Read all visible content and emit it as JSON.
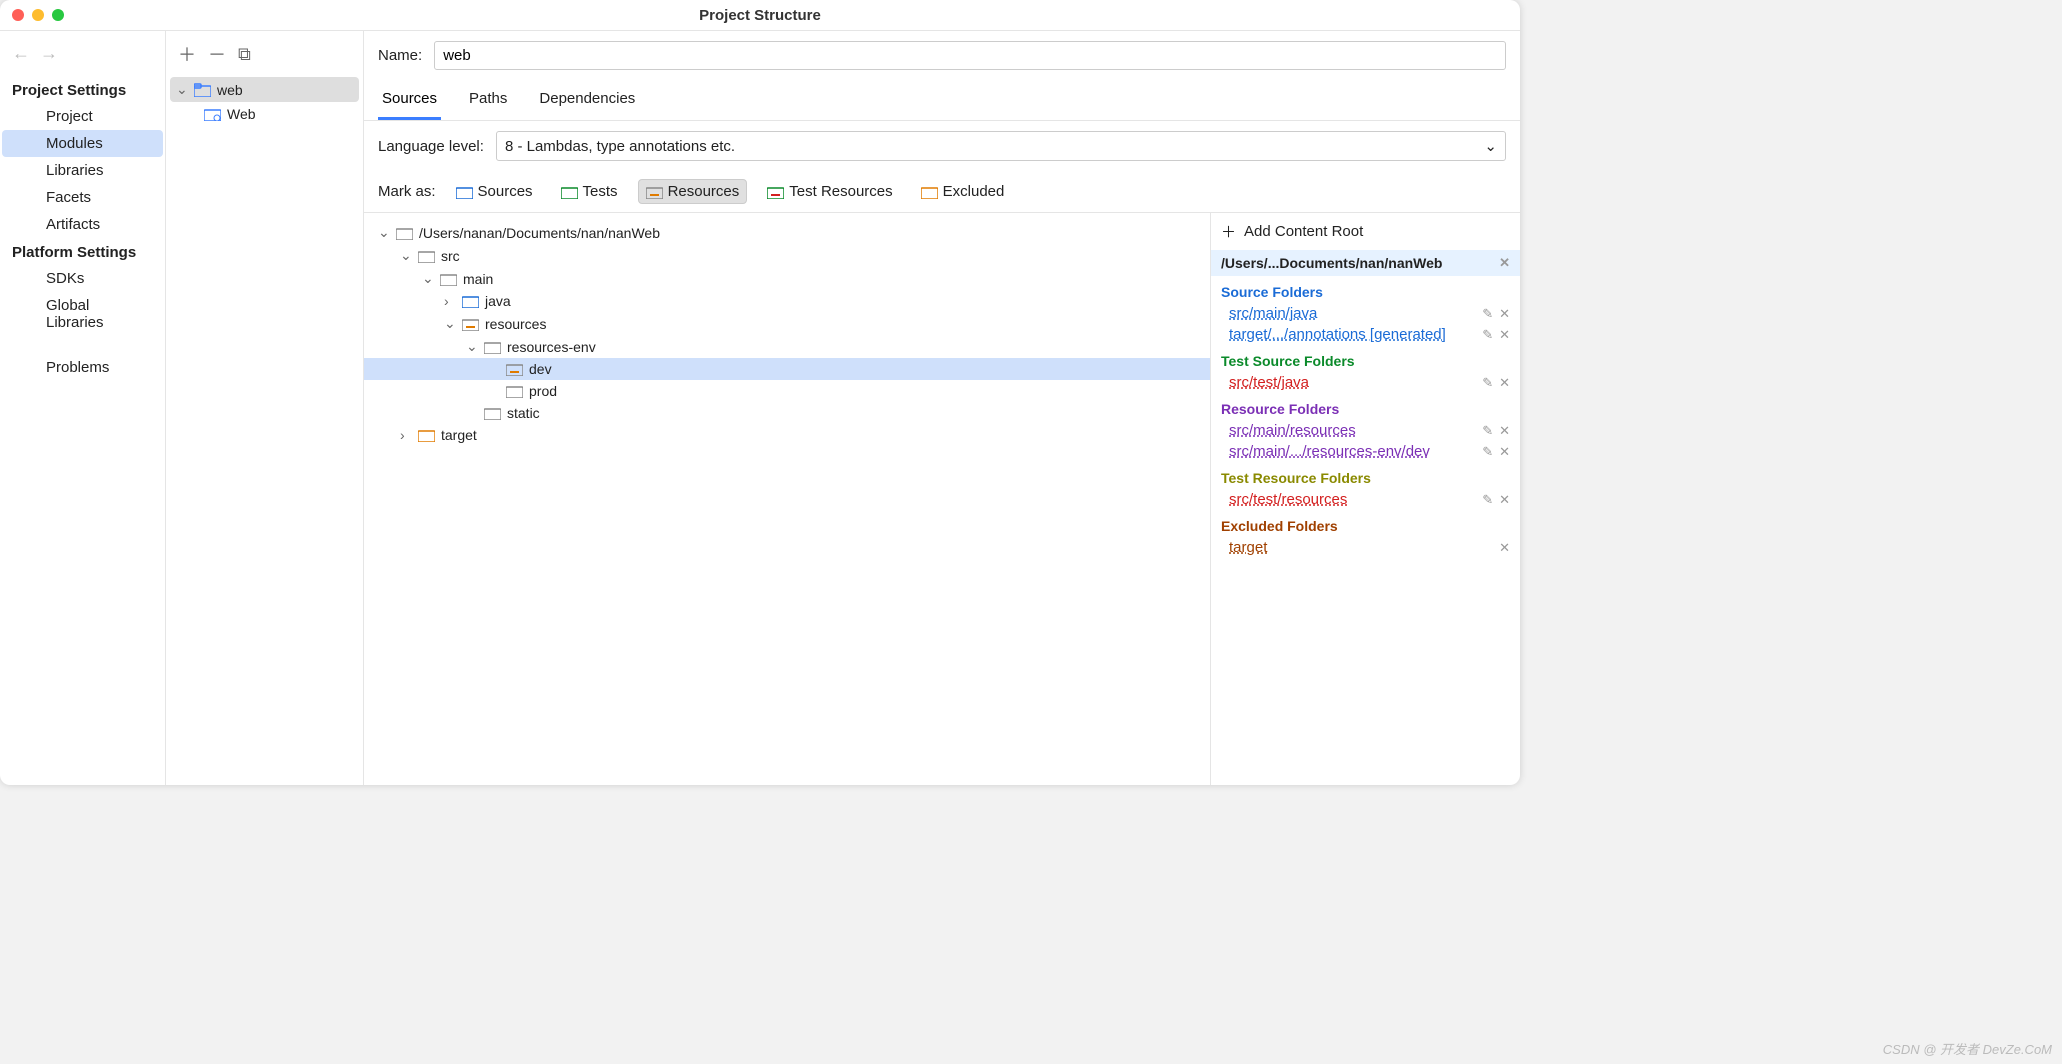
{
  "window": {
    "title": "Project Structure"
  },
  "sidebar": {
    "section1": "Project Settings",
    "items1": [
      "Project",
      "Modules",
      "Libraries",
      "Facets",
      "Artifacts"
    ],
    "selected1": "Modules",
    "section2": "Platform Settings",
    "items2": [
      "SDKs",
      "Global Libraries"
    ],
    "problems": "Problems"
  },
  "modules": {
    "root": "web",
    "child": "Web"
  },
  "main": {
    "name_label": "Name:",
    "name_value": "web",
    "tabs": [
      "Sources",
      "Paths",
      "Dependencies"
    ],
    "active_tab": "Sources",
    "lang_label": "Language level:",
    "lang_value": "8 - Lambdas, type annotations etc.",
    "mark_label": "Mark as:",
    "mark_buttons": [
      {
        "label": "Sources",
        "color": "#1a6bd6"
      },
      {
        "label": "Tests",
        "color": "#0a8a2a"
      },
      {
        "label": "Resources",
        "color": "#e07b00",
        "selected": true
      },
      {
        "label": "Test Resources",
        "color": "#0a8a2a"
      },
      {
        "label": "Excluded",
        "color": "#e07b00"
      }
    ],
    "tree": {
      "root": "/Users/nanan/Documents/nan/nanWeb",
      "src": "src",
      "main_": "main",
      "java": "java",
      "resources": "resources",
      "resenv": "resources-env",
      "dev": "dev",
      "prod": "prod",
      "static": "static",
      "target": "target"
    }
  },
  "rightpane": {
    "add_root": "Add Content Root",
    "root_path": "/Users/...Documents/nan/nanWeb",
    "groups": [
      {
        "title": "Source Folders",
        "color": "c-blue",
        "items": [
          {
            "t": "src/main/java",
            "c": "c-blue"
          },
          {
            "t": "target/.../annotations [generated]",
            "c": "c-blue"
          }
        ]
      },
      {
        "title": "Test Source Folders",
        "color": "c-green",
        "items": [
          {
            "t": "src/test/java",
            "c": "c-red"
          }
        ]
      },
      {
        "title": "Resource Folders",
        "color": "c-purple",
        "items": [
          {
            "t": "src/main/resources",
            "c": "c-purple"
          },
          {
            "t": "src/main/.../resources-env/dev",
            "c": "c-purple"
          }
        ]
      },
      {
        "title": "Test Resource Folders",
        "color": "c-olive",
        "items": [
          {
            "t": "src/test/resources",
            "c": "c-red"
          }
        ]
      },
      {
        "title": "Excluded Folders",
        "color": "c-brown",
        "items": [
          {
            "t": "target",
            "c": "c-brown",
            "noedit": true
          }
        ]
      }
    ]
  },
  "watermark": "CSDN @ 开发者 DevZe.CoM"
}
